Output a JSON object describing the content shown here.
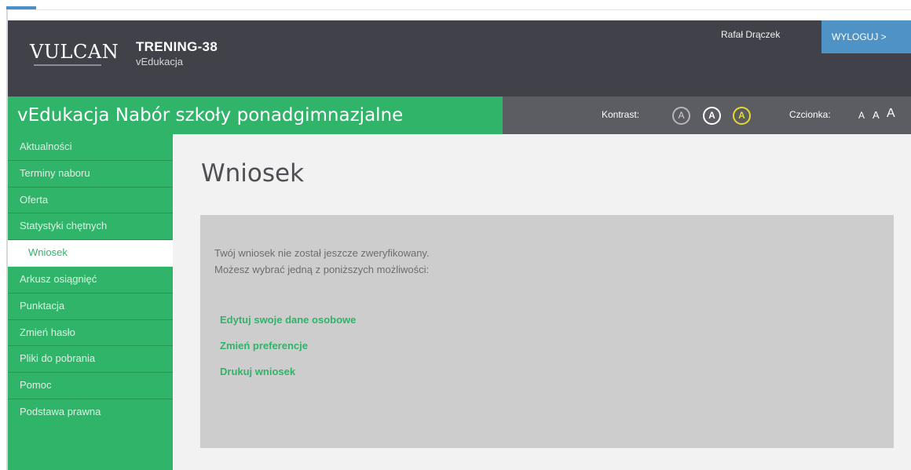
{
  "header": {
    "logo_text": "VULCAN",
    "school_name": "TRENING-38",
    "school_sub": "vEdukacja",
    "user_name": "Rafał Drączek",
    "logout_label": "WYLOGUJ >"
  },
  "module_bar": {
    "title": "vEdukacja Nabór szkoły ponadgimnazjalne",
    "contrast_label": "Kontrast:",
    "contrast_options": [
      "A",
      "A",
      "A"
    ],
    "font_label": "Czcionka:",
    "font_options": [
      "A",
      "A",
      "A"
    ]
  },
  "sidebar": {
    "items": [
      {
        "label": "Aktualności"
      },
      {
        "label": "Terminy naboru"
      },
      {
        "label": "Oferta"
      },
      {
        "label": "Statystyki chętnych"
      },
      {
        "label": "Wniosek"
      },
      {
        "label": "Arkusz osiągnięć"
      },
      {
        "label": "Punktacja"
      },
      {
        "label": "Zmień hasło"
      },
      {
        "label": "Pliki do pobrania"
      },
      {
        "label": "Pomoc"
      },
      {
        "label": "Podstawa prawna"
      }
    ],
    "active_index": 4
  },
  "main": {
    "title": "Wniosek",
    "message_line1": "Twój wniosek nie został jeszcze zweryfikowany.",
    "message_line2": "Możesz wybrać jedną z poniższych możliwości:",
    "links": [
      {
        "label": "Edytuj swoje dane osobowe"
      },
      {
        "label": "Zmień preferencje"
      },
      {
        "label": "Drukuj wniosek"
      }
    ]
  },
  "colors": {
    "accent_green": "#2fb46a",
    "header_dark": "#414149",
    "logout_blue": "#4f92c6",
    "contrast_yellow": "#e6da2c"
  }
}
